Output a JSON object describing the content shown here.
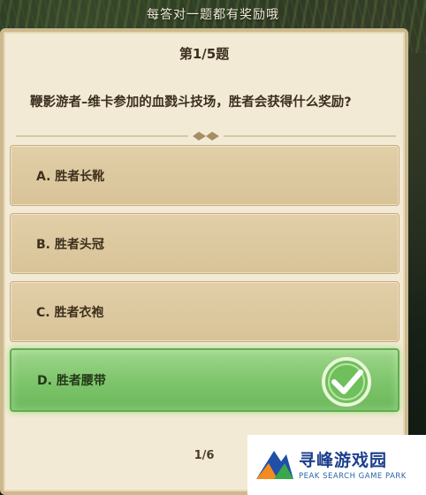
{
  "banner": {
    "text": "每答对一题都有奖励哦"
  },
  "quiz": {
    "progress": "第1/5题",
    "question": "鞭影游者–维卡参加的血戮斗技场，胜者会获得什么奖励?",
    "options": [
      {
        "label": "A. 胜者长靴",
        "state": "normal"
      },
      {
        "label": "B. 胜者头冠",
        "state": "normal"
      },
      {
        "label": "C. 胜者衣袍",
        "state": "normal"
      },
      {
        "label": "D. 胜者腰带",
        "state": "correct"
      }
    ],
    "page": "1/6"
  },
  "logo": {
    "name": "寻峰游戏园",
    "subtitle": "PEAK SEARCH GAME PARK"
  },
  "colors": {
    "card_bg": "#f3ead6",
    "option_bg": "#dcc89f",
    "correct_bg": "#7dc46a",
    "text_dark": "#3b2e1e"
  },
  "icons": {
    "correct_mark": "check-circle-icon",
    "divider": "ornament-divider-icon",
    "logo_mark": "mountain-logo-icon"
  }
}
